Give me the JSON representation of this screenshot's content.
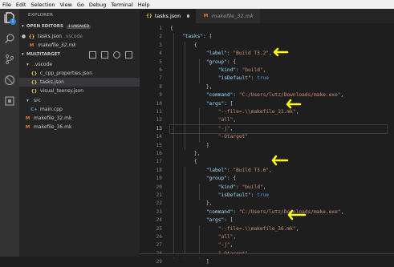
{
  "menu": [
    "File",
    "Edit",
    "Selection",
    "View",
    "Go",
    "Debug",
    "Terminal",
    "Help"
  ],
  "activity_badge": "1",
  "sidebar": {
    "title": "EXPLORER",
    "open_editors": {
      "label": "OPEN EDITORS",
      "badge": "1 UNSAVED",
      "files": [
        {
          "name": "tasks.json",
          "folder": ".vscode",
          "icon": "json-icon",
          "modified": true
        },
        {
          "name": "makefile_32.mk",
          "folder": "",
          "icon": "makefile-icon",
          "modified": false
        }
      ]
    },
    "workspace": {
      "label": "MULTITARGET",
      "items": [
        {
          "name": ".vscode",
          "type": "folder",
          "icon": "folder-icon"
        },
        {
          "name": "c_cpp_properties.json",
          "type": "file",
          "icon": "json-icon"
        },
        {
          "name": "tasks.json",
          "type": "file",
          "icon": "json-icon",
          "active": true
        },
        {
          "name": "visual_teensy.json",
          "type": "file",
          "icon": "json-icon"
        },
        {
          "name": "src",
          "type": "folder",
          "icon": "folder-icon"
        },
        {
          "name": "main.cpp",
          "type": "file",
          "icon": "cpp-icon"
        },
        {
          "name": "makefile_32.mk",
          "type": "file",
          "icon": "makefile-icon"
        },
        {
          "name": "makefile_36.mk",
          "type": "file",
          "icon": "makefile-icon"
        }
      ]
    }
  },
  "tabs": [
    {
      "label": "tasks.json",
      "active": true,
      "dirty": true
    },
    {
      "label": "makefile_32.mk",
      "active": false,
      "dirty": false
    }
  ],
  "editor": {
    "current_line": 13,
    "lines": [
      {
        "n": "1",
        "text": "{"
      },
      {
        "n": "2",
        "text": "    \"tasks\": ["
      },
      {
        "n": "3",
        "text": "        {"
      },
      {
        "n": "4",
        "text": "            \"label\": \"Build T3.2\","
      },
      {
        "n": "5",
        "text": "            \"group\": {"
      },
      {
        "n": "6",
        "text": "                \"kind\": \"build\","
      },
      {
        "n": "7",
        "text": "                \"isDefault\": true"
      },
      {
        "n": "8",
        "text": "            },"
      },
      {
        "n": "9",
        "text": "            \"command\": \"C:/Users/lutz/Downloads/make.exe\","
      },
      {
        "n": "10",
        "text": "            \"args\": ["
      },
      {
        "n": "11",
        "text": "                \"--file=.\\\\makefile_32.mk\","
      },
      {
        "n": "12",
        "text": "                \"all\","
      },
      {
        "n": "13",
        "text": "                \"-j\","
      },
      {
        "n": "14",
        "text": "                \"-Otarget\""
      },
      {
        "n": "15",
        "text": "            ]"
      },
      {
        "n": "16",
        "text": "        },"
      },
      {
        "n": "17",
        "text": "        {"
      },
      {
        "n": "18",
        "text": "            \"label\": \"Build T3.6\","
      },
      {
        "n": "19",
        "text": "            \"group\": {"
      },
      {
        "n": "20",
        "text": "                \"kind\": \"build\","
      },
      {
        "n": "21",
        "text": "                \"isDefault\": true"
      },
      {
        "n": "22",
        "text": "            },"
      },
      {
        "n": "23",
        "text": "            \"command\": \"C:/Users/lutz/Downloads/make.exe\","
      },
      {
        "n": "24",
        "text": "            \"args\": ["
      },
      {
        "n": "25",
        "text": "                \"--file=.\\\\makefile_36.mk\","
      },
      {
        "n": "26",
        "text": "                \"all\","
      },
      {
        "n": "27",
        "text": "                \"-j\","
      },
      {
        "n": "28",
        "text": "                \"-Otarget\""
      },
      {
        "n": "29",
        "text": "            ]"
      }
    ]
  },
  "annotation_color": "#ffff00"
}
